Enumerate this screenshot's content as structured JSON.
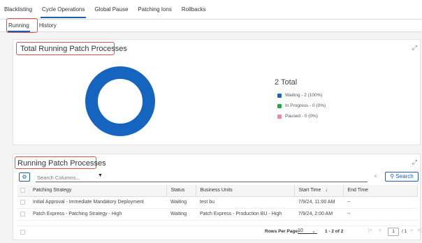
{
  "top_tabs": [
    "Blacklisting",
    "Cycle Operations",
    "Global Pause",
    "Patching Ions",
    "Rollbacks"
  ],
  "sub_tabs": [
    "Running",
    "History"
  ],
  "chart_panel": {
    "title": "Total Running Patch Processes",
    "total_label": "2 Total"
  },
  "chart_data": {
    "type": "pie",
    "categories": [
      "Waiting",
      "In Progress",
      "Paused"
    ],
    "values": [
      2,
      0,
      0
    ],
    "legend_labels": [
      "Waiting - 2 (100%)",
      "In Progress - 0 (0%)",
      "Paused - 0 (0%)"
    ],
    "colors": [
      "#1565c0",
      "#22a84a",
      "#f08a8e"
    ],
    "legend_position": "right"
  },
  "table_panel": {
    "title": "Running Patch Processes",
    "search_placeholder": "Search Columns...",
    "search_button": "Search",
    "clear_icon": "×",
    "columns": [
      "Patching Strategy",
      "Status",
      "Business Units",
      "Start Time",
      "End Time"
    ],
    "sort_icon": "↓",
    "rows": [
      [
        "Initial Approval - Immediate Mandatory Deployment",
        "Waiting",
        "test bu",
        "7/9/24, 11:00 AM",
        "--"
      ],
      [
        "Patch Express - Patching Strategy - High",
        "Waiting",
        "Patch Express - Production BU - High",
        "7/9/24, 2:00 AM",
        "--"
      ]
    ],
    "footer": {
      "rows_per_page_label": "Rows Per Page:",
      "rows_per_page": "10",
      "range": "1 - 2 of 2",
      "current_page": "1",
      "page_of": "/ 1"
    }
  }
}
